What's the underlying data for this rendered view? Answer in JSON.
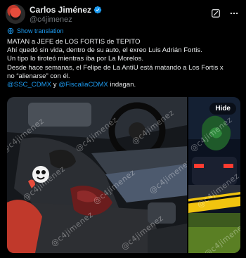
{
  "author": {
    "name": "Carlos Jiménez",
    "handle": "@c4jimenez"
  },
  "actions": {
    "grok_icon": "grok-icon",
    "more_icon": "more-icon"
  },
  "translation": {
    "label": "Show translation"
  },
  "tweet": {
    "line1": "MATAN a JEFE de LOS FORTIS de TEPITO",
    "line2": "Ahí quedó sin vida, dentro de su auto, el exreo Luis Adrián Fortis.",
    "line3": "Un tipo lo tiroteó mientras iba por La Morelos.",
    "line4": "Desde hace semanas, el Felipe de La AntiU está matando a Los Fortis x",
    "line5": "no “alienarse” con él.",
    "mention1": "@SSC_CDMX",
    "connector": " y ",
    "mention2": "@FiscaliaCDMX",
    "ending": " indagan."
  },
  "media": {
    "watermark": "@c4jimenez",
    "hide_label": "Hide"
  },
  "colors": {
    "link": "#1d9bf0",
    "verified": "#1d9bf0"
  }
}
